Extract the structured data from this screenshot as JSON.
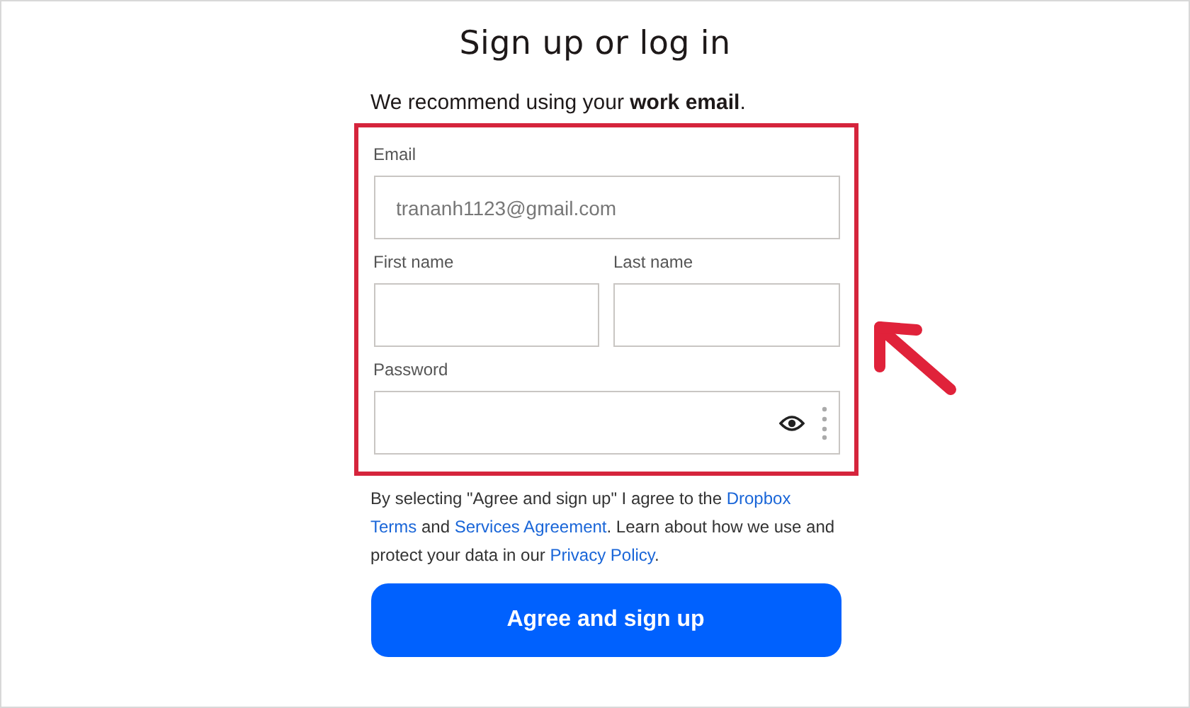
{
  "title": "Sign up or log in",
  "subtitle": "We recommend using your **work email**.",
  "highlighted": true,
  "email": {
    "label": "Email",
    "value": "trananh1123@gmail.com"
  },
  "first_name": {
    "label": "First name"
  },
  "last_name": {
    "label": "Last name"
  },
  "password": {
    "label": "Password"
  },
  "legal": [
    {
      "text": "By selecting \"Agree and sign up\" I agree to the ",
      "link": false
    },
    {
      "text": "Dropbox",
      "link": true,
      "line_break_after": true
    },
    {
      "text": "Terms",
      "link": true
    },
    {
      "text": " and ",
      "link": false
    },
    {
      "text": "Services Agreement",
      "link": true
    },
    {
      "text": ". Learn about how we use and protect your data in our ",
      "link": false
    },
    {
      "text": "Privacy Policy",
      "link": true
    },
    {
      "text": ".",
      "link": false
    }
  ],
  "submit_button": "Agree and sign up"
}
